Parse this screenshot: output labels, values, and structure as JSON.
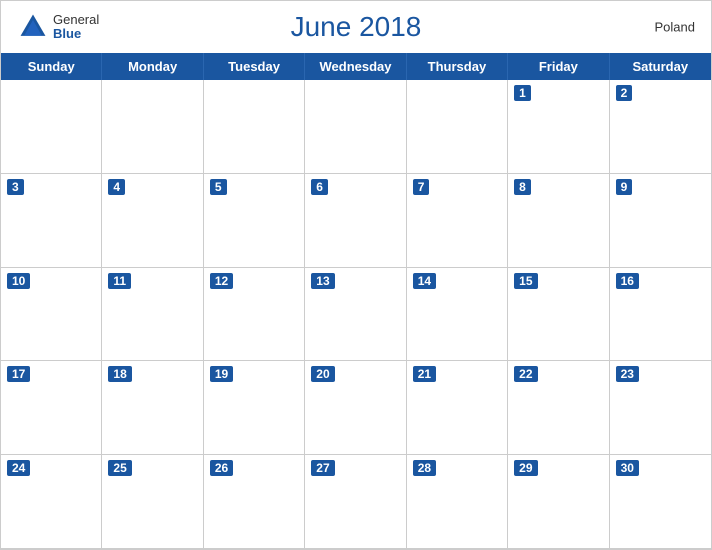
{
  "calendar": {
    "title": "June 2018",
    "country": "Poland",
    "logo": {
      "line1": "General",
      "line2": "Blue"
    },
    "days_of_week": [
      "Sunday",
      "Monday",
      "Tuesday",
      "Wednesday",
      "Thursday",
      "Friday",
      "Saturday"
    ],
    "weeks": [
      [
        {
          "date": "",
          "empty": true
        },
        {
          "date": "",
          "empty": true
        },
        {
          "date": "",
          "empty": true
        },
        {
          "date": "",
          "empty": true
        },
        {
          "date": "",
          "empty": true
        },
        {
          "date": "1",
          "empty": false
        },
        {
          "date": "2",
          "empty": false
        }
      ],
      [
        {
          "date": "3",
          "empty": false
        },
        {
          "date": "4",
          "empty": false
        },
        {
          "date": "5",
          "empty": false
        },
        {
          "date": "6",
          "empty": false
        },
        {
          "date": "7",
          "empty": false
        },
        {
          "date": "8",
          "empty": false
        },
        {
          "date": "9",
          "empty": false
        }
      ],
      [
        {
          "date": "10",
          "empty": false
        },
        {
          "date": "11",
          "empty": false
        },
        {
          "date": "12",
          "empty": false
        },
        {
          "date": "13",
          "empty": false
        },
        {
          "date": "14",
          "empty": false
        },
        {
          "date": "15",
          "empty": false
        },
        {
          "date": "16",
          "empty": false
        }
      ],
      [
        {
          "date": "17",
          "empty": false
        },
        {
          "date": "18",
          "empty": false
        },
        {
          "date": "19",
          "empty": false
        },
        {
          "date": "20",
          "empty": false
        },
        {
          "date": "21",
          "empty": false
        },
        {
          "date": "22",
          "empty": false
        },
        {
          "date": "23",
          "empty": false
        }
      ],
      [
        {
          "date": "24",
          "empty": false
        },
        {
          "date": "25",
          "empty": false
        },
        {
          "date": "26",
          "empty": false
        },
        {
          "date": "27",
          "empty": false
        },
        {
          "date": "28",
          "empty": false
        },
        {
          "date": "29",
          "empty": false
        },
        {
          "date": "30",
          "empty": false
        }
      ]
    ]
  }
}
